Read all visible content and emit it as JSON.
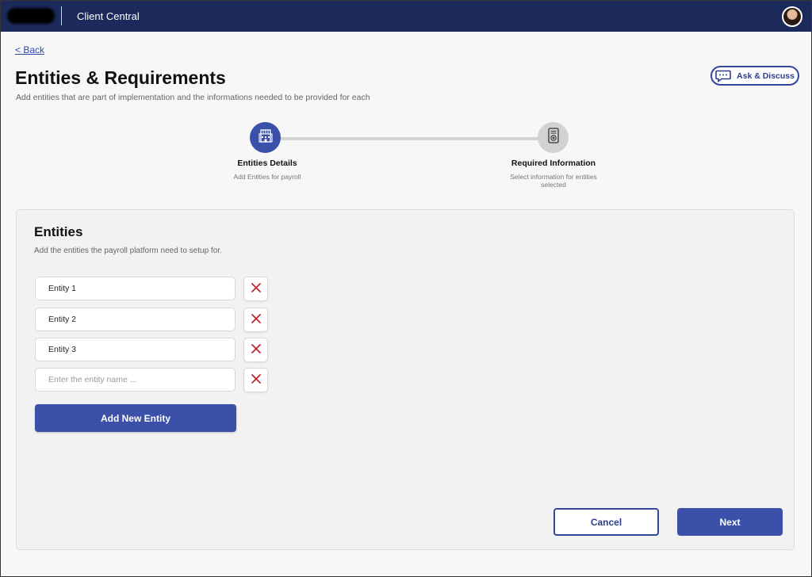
{
  "header": {
    "app_title": "Client Central",
    "logo_icon": "company-logo-redacted",
    "avatar_icon": "user-avatar"
  },
  "nav": {
    "back_label": "< Back"
  },
  "page": {
    "title": "Entities & Requirements",
    "subtitle": "Add entities that are part of implementation and the informations needed to be provided for each",
    "ask_label": "Ask & Discuss"
  },
  "stepper": {
    "steps": [
      {
        "title": "Entities Details",
        "subtitle": "Add Entities for payroll",
        "state": "active",
        "icon": "building-icon"
      },
      {
        "title": "Required Information",
        "subtitle": "Select information for entities selected",
        "state": "inactive",
        "icon": "medical-form-icon"
      }
    ]
  },
  "entities_card": {
    "title": "Entities",
    "subtitle": "Add the entities the payroll platform need to setup for.",
    "entities": [
      {
        "value": "Entity 1",
        "placeholder": ""
      },
      {
        "value": "Entity 2",
        "placeholder": ""
      },
      {
        "value": "Entity 3",
        "placeholder": ""
      },
      {
        "value": "",
        "placeholder": "Enter the entity name ..."
      }
    ],
    "add_label": "Add New Entity"
  },
  "footer": {
    "cancel_label": "Cancel",
    "next_label": "Next"
  },
  "colors": {
    "header_bg": "#1c2a5b",
    "primary": "#3b50a8",
    "remove_icon": "#c0282d",
    "inactive_step": "#d2d2d2"
  }
}
